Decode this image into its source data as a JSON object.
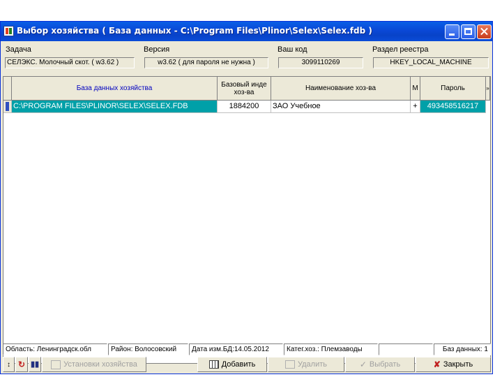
{
  "window": {
    "title": "Выбор хозяйства ( База данных - C:\\Program Files\\Plinor\\Selex\\Selex.fdb )"
  },
  "fields": {
    "task_label": "Задача",
    "task_value": "СЕЛЭКС. Молочный скот. ( w3.62 )",
    "version_label": "Версия",
    "version_value": "w3.62 ( для пароля не нужна )",
    "code_label": "Ваш код",
    "code_value": "3099110269",
    "registry_label": "Раздел реестра",
    "registry_value": "HKEY_LOCAL_MACHINE"
  },
  "grid": {
    "columns": [
      "База данных хозяйства",
      "Базовый инде хоз-ва",
      "Наименование хоз-ва",
      "М",
      "Пароль",
      "»"
    ],
    "rows": [
      {
        "db": "C:\\PROGRAM FILES\\PLINOR\\SELEX\\SELEX.FDB",
        "index": "1884200",
        "name": "ЗАО Учебное",
        "m": "+",
        "password": "493458516217"
      }
    ]
  },
  "status": {
    "region": "Область: Ленинградск.обл",
    "district": "Район: Волосовский",
    "date": "Дата изм.БД:14.05.2012",
    "category": "Катег.хоз.: Племзаводы",
    "count": "Баз данных: 1"
  },
  "toolbar": {
    "settings": "Установки хозяйства",
    "add": "Добавить",
    "delete": "Удалить",
    "select": "Выбрать",
    "close": "Закрыть"
  },
  "colors": {
    "titlebar": "#0a4cd8",
    "selection": "#00a0a8",
    "header_text": "#0000c0"
  }
}
